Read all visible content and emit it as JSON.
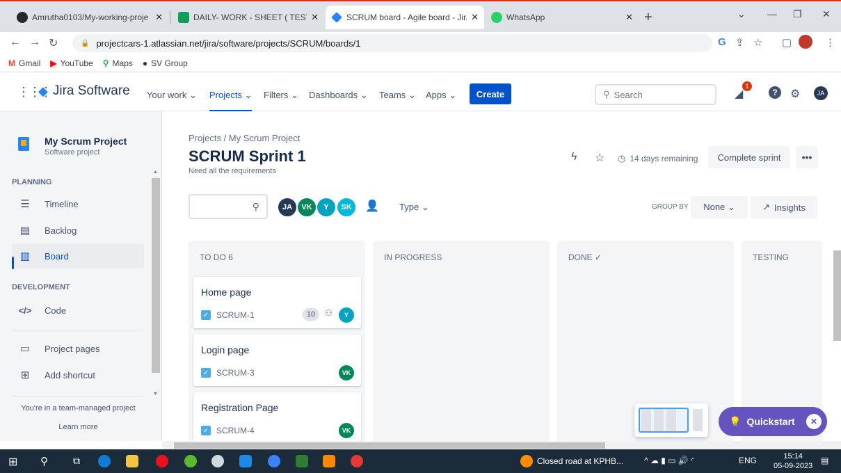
{
  "browser": {
    "tabs": [
      {
        "title": "Amrutha0103/My-working-proje",
        "close": "✕",
        "active": false
      },
      {
        "title": "DAILY- WORK - SHEET ( TESTING",
        "close": "✕",
        "active": false
      },
      {
        "title": "SCRUM board - Agile board - Jira",
        "close": "✕",
        "active": true
      },
      {
        "title": "WhatsApp",
        "close": "✕",
        "active": false
      }
    ],
    "url": "projectcars-1.atlassian.net/jira/software/projects/SCRUM/boards/1",
    "bookmarks": [
      "Gmail",
      "YouTube",
      "Maps",
      "SV Group"
    ]
  },
  "jira": {
    "product": "Jira Software",
    "menu": [
      "Your work ⌄",
      "Projects ⌄",
      "Filters ⌄",
      "Dashboards ⌄",
      "Teams ⌄",
      "Apps ⌄"
    ],
    "create_label": "Create",
    "search_placeholder": "Search",
    "notification_count": "1",
    "user_initials": "JA"
  },
  "sidebar": {
    "project_name": "My Scrum Project",
    "project_type": "Software project",
    "planning_label": "PLANNING",
    "items": [
      "Timeline",
      "Backlog",
      "Board"
    ],
    "development_label": "DEVELOPMENT",
    "code_label": "Code",
    "project_pages": "Project pages",
    "add_shortcut": "Add shortcut",
    "footer_text": "You're in a team-managed project",
    "learn_more": "Learn more"
  },
  "board": {
    "breadcrumb": "Projects  /  My Scrum Project",
    "title": "SCRUM Sprint 1",
    "goal": "Need all the requirements",
    "remaining": "14 days remaining",
    "complete_label": "Complete sprint",
    "more_label": "•••",
    "avatars": [
      {
        "initials": "JA",
        "color": "#253858"
      },
      {
        "initials": "VK",
        "color": "#00875a"
      },
      {
        "initials": "Y",
        "color": "#00a3bf"
      },
      {
        "initials": "SK",
        "color": "#00b8d9"
      }
    ],
    "type_filter": "Type ⌄",
    "group_by_label": "GROUP BY",
    "group_by_value": "None ⌄",
    "insights_label": "Insights",
    "columns": [
      {
        "title": "TO DO 6"
      },
      {
        "title": "IN PROGRESS"
      },
      {
        "title": "DONE ✓"
      },
      {
        "title": "TESTING"
      }
    ],
    "cards": [
      {
        "title": "Home page",
        "key": "SCRUM-1",
        "points": "10",
        "assignee": "Y",
        "color": "#00a3bf"
      },
      {
        "title": "Login page",
        "key": "SCRUM-3",
        "assignee": "VK",
        "color": "#00875a"
      },
      {
        "title": "Registration Page",
        "key": "SCRUM-4",
        "assignee": "VK",
        "color": "#00875a"
      }
    ],
    "quickstart_label": "Quickstart"
  },
  "taskbar": {
    "notification": "Closed road at KPHB...",
    "lang": "ENG",
    "time": "15:14",
    "date": "05-09-2023"
  }
}
